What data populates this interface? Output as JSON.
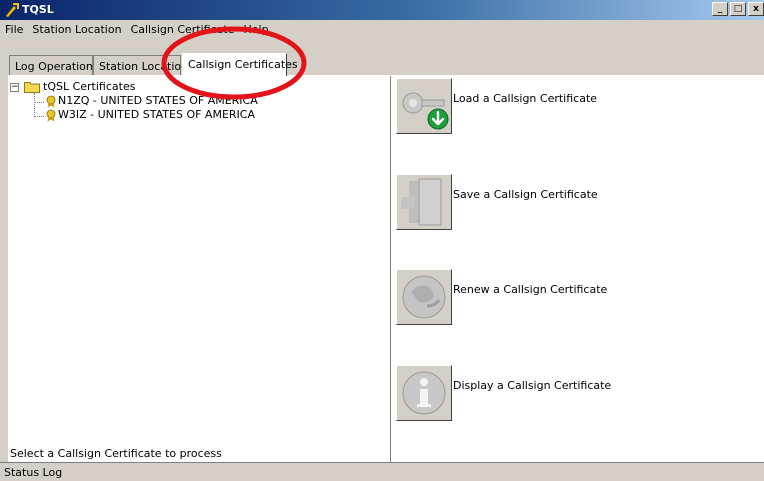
{
  "window": {
    "title": "TQSL",
    "controls": [
      "_",
      "□",
      "x"
    ]
  },
  "menu": [
    "File",
    "Station Location",
    "Callsign Certificate",
    "Help"
  ],
  "tabs": [
    {
      "label": "Log Operations",
      "active": false
    },
    {
      "label": "Station Locations",
      "active": false
    },
    {
      "label": "Callsign Certificates",
      "active": true
    }
  ],
  "tree": {
    "root": "tQSL Certificates",
    "expander": "−",
    "children": [
      "N1ZQ - UNITED STATES OF AMERICA",
      "W3IZ - UNITED STATES OF AMERICA"
    ]
  },
  "left_status": "Select a Callsign Certificate to process",
  "actions": [
    {
      "label": "Load a Callsign Certificate",
      "icon": "load-certificate-icon"
    },
    {
      "label": "Save a Callsign Certificate",
      "icon": "save-certificate-icon"
    },
    {
      "label": "Renew a Callsign Certificate",
      "icon": "renew-certificate-icon"
    },
    {
      "label": "Display a Callsign Certificate",
      "icon": "display-certificate-icon"
    }
  ],
  "statusbar": "Status Log",
  "colors": {
    "annotation": "#e2141a",
    "title_bar": "#0a246a",
    "download_arrow": "#1e9e3a",
    "folder": "#f5d84a"
  }
}
